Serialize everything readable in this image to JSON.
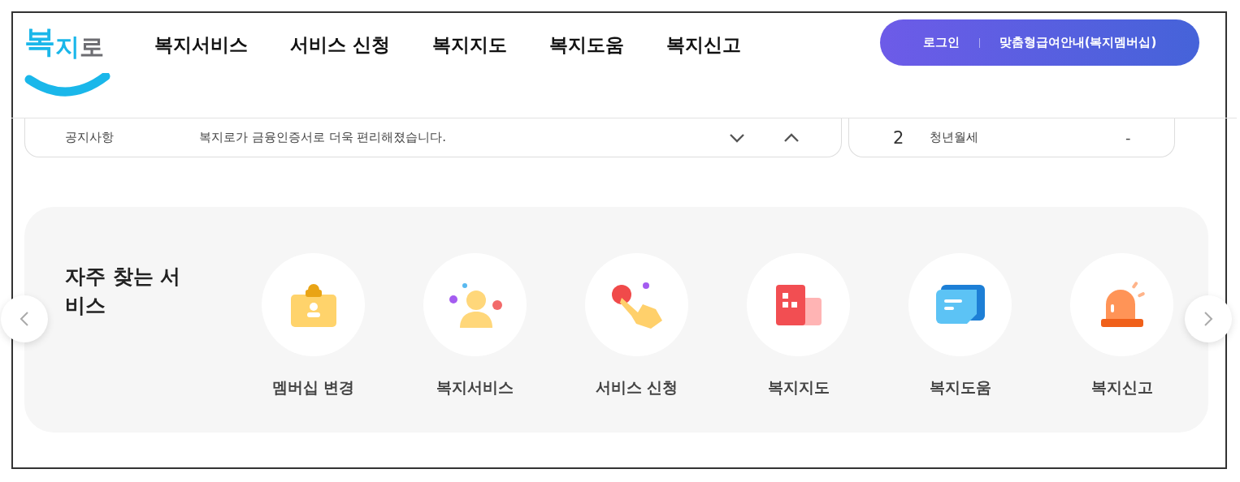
{
  "logo": "복지로",
  "nav": [
    "복지서비스",
    "서비스 신청",
    "복지지도",
    "복지도움",
    "복지신고"
  ],
  "account": {
    "login": "로그인",
    "membership": "맞춤형급여안내(복지멤버십)"
  },
  "notice": {
    "label": "공지사항",
    "text": "복지로가 금융인증서로 더욱 편리해졌습니다."
  },
  "ranking": {
    "rank": "2",
    "title": "청년월세",
    "change": "-"
  },
  "services": {
    "title": "자주 찾는 서비스",
    "items": [
      {
        "label": "멤버십 변경"
      },
      {
        "label": "복지서비스"
      },
      {
        "label": "서비스 신청"
      },
      {
        "label": "복지지도"
      },
      {
        "label": "복지도움"
      },
      {
        "label": "복지신고"
      }
    ]
  }
}
